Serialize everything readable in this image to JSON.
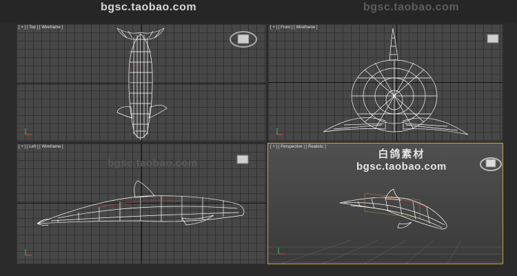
{
  "watermark": {
    "url": "bgsc.taobao.com",
    "brand": "白鸽素材"
  },
  "viewports": {
    "top": {
      "label": "[ + ] [ Top ] [ Wireframe ]"
    },
    "front": {
      "label": "[ + ] [ Front ] [ Wireframe ]"
    },
    "left": {
      "label": "[ + ] [ Left ] [ Wireframe ]"
    },
    "perspective": {
      "label": "[ + ] [ Perspective ] [ Realistic ]"
    }
  },
  "colors": {
    "grid_bg": "#474747",
    "grid_line": "#333333",
    "wire": "#ffffff",
    "active_border": "#c8a84a"
  },
  "icons": [
    "viewcube-icon",
    "axis-gizmo-icon"
  ]
}
